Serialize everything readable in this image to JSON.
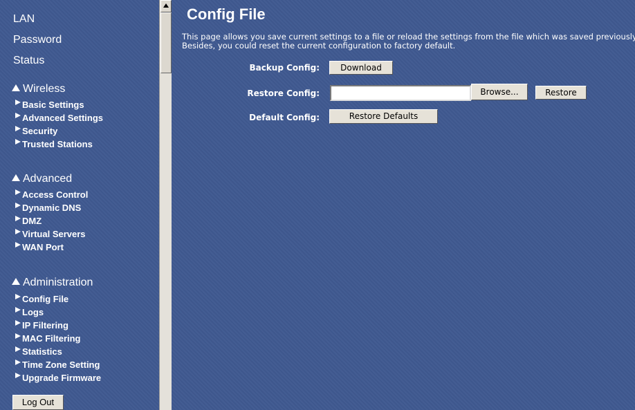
{
  "sidebar": {
    "top_items": [
      {
        "label": "LAN"
      },
      {
        "label": "Password"
      },
      {
        "label": "Status"
      }
    ],
    "sections": [
      {
        "title": "Wireless",
        "items": [
          "Basic Settings",
          "Advanced Settings",
          "Security",
          "Trusted Stations"
        ]
      },
      {
        "title": "Advanced",
        "items": [
          "Access Control",
          "Dynamic DNS",
          "DMZ",
          "Virtual Servers",
          "WAN Port"
        ]
      },
      {
        "title": "Administration",
        "items": [
          "Config File",
          "Logs",
          "IP Filtering",
          "MAC Filtering",
          "Statistics",
          "Time Zone Setting",
          "Upgrade Firmware"
        ]
      }
    ],
    "logout_label": "Log Out"
  },
  "main": {
    "title": "Config File",
    "description": "This page allows you save current settings to a file or reload the settings from the file which was saved previously. Besides, you could reset the current configuration to factory default.",
    "backup": {
      "label": "Backup Config:",
      "button": "Download"
    },
    "restore": {
      "label": "Restore Config:",
      "file_value": "",
      "browse_button": "Browse...",
      "button": "Restore"
    },
    "default": {
      "label": "Default Config:",
      "button": "Restore Defaults"
    }
  },
  "colors": {
    "background": "#3f5990",
    "button_face": "#e6e2d8",
    "text": "#ffffff"
  }
}
